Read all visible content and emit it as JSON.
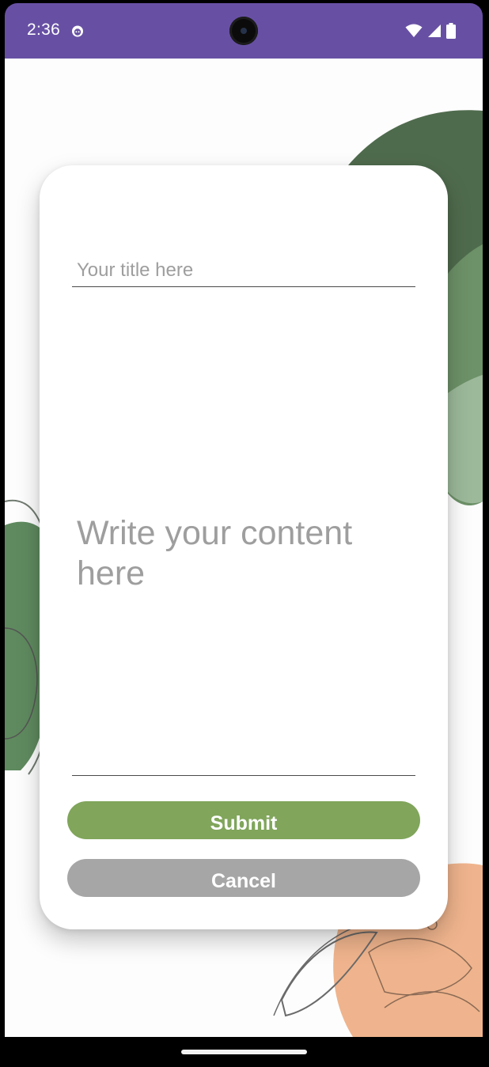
{
  "status_bar": {
    "time": "2:36",
    "app_icon": "android-robot-icon",
    "icons": [
      "wifi-icon",
      "cellular-signal-icon",
      "battery-icon"
    ],
    "background_color": "#6750a4"
  },
  "form": {
    "title_placeholder": "Your title here",
    "content_placeholder": "Write your content here",
    "submit_label": "Submit",
    "cancel_label": "Cancel"
  },
  "colors": {
    "submit": "#80a55b",
    "cancel": "#a6a6a6",
    "background_art_green": "#4f6b4d",
    "background_art_peach": "#efb48d"
  }
}
